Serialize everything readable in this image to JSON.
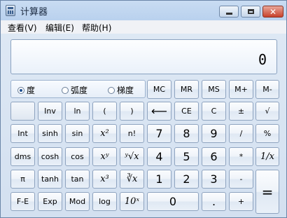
{
  "window": {
    "title": "计算器"
  },
  "menu": {
    "items": [
      "查看(V)",
      "编辑(E)",
      "帮助(H)"
    ]
  },
  "display": {
    "value": "0"
  },
  "angle_mode": {
    "options": [
      "度",
      "弧度",
      "梯度"
    ],
    "selected": "度"
  },
  "buttons": {
    "mc": "MC",
    "mr": "MR",
    "ms": "MS",
    "mplus": "M+",
    "mminus": "M-",
    "inv": "Inv",
    "ln": "ln",
    "lparen": "(",
    "rparen": ")",
    "backspace": "⟵",
    "ce": "CE",
    "c": "C",
    "negate": "±",
    "sqrt": "√",
    "int": "Int",
    "sinh": "sinh",
    "sin": "sin",
    "square": "x²",
    "factorial": "n!",
    "d7": "7",
    "d8": "8",
    "d9": "9",
    "divide": "/",
    "percent": "%",
    "dms": "dms",
    "cosh": "cosh",
    "cos": "cos",
    "power": "xʸ",
    "yroot": "ʸ√x",
    "d4": "4",
    "d5": "5",
    "d6": "6",
    "multiply": "*",
    "reciprocal": "1/x",
    "pi": "π",
    "tanh": "tanh",
    "tan": "tan",
    "cube": "x³",
    "cuberoot": "∛x",
    "d1": "1",
    "d2": "2",
    "d3": "3",
    "subtract": "-",
    "equals": "=",
    "fe": "F-E",
    "exp": "Exp",
    "mod": "Mod",
    "log": "log",
    "tenpow": "10ˣ",
    "d0": "0",
    "decimal": ".",
    "add": "+"
  }
}
